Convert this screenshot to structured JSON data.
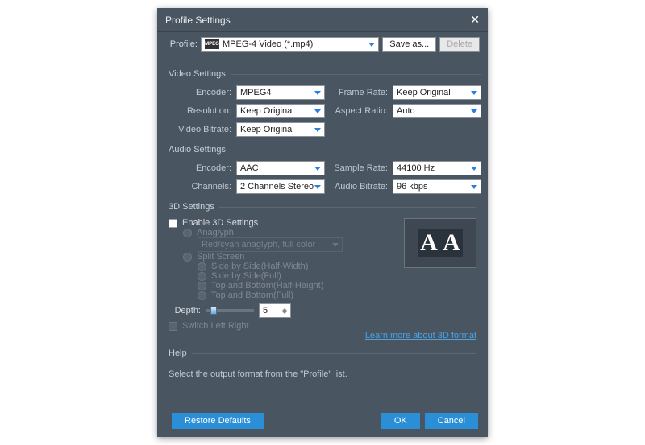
{
  "title": "Profile Settings",
  "profile": {
    "label": "Profile:",
    "value": "MPEG-4 Video (*.mp4)",
    "save_as": "Save as...",
    "delete": "Delete"
  },
  "video": {
    "legend": "Video Settings",
    "encoder_label": "Encoder:",
    "encoder": "MPEG4",
    "resolution_label": "Resolution:",
    "resolution": "Keep Original",
    "bitrate_label": "Video Bitrate:",
    "bitrate": "Keep Original",
    "framerate_label": "Frame Rate:",
    "framerate": "Keep Original",
    "aspect_label": "Aspect Ratio:",
    "aspect": "Auto"
  },
  "audio": {
    "legend": "Audio Settings",
    "encoder_label": "Encoder:",
    "encoder": "AAC",
    "channels_label": "Channels:",
    "channels": "2 Channels Stereo",
    "samplerate_label": "Sample Rate:",
    "samplerate": "44100 Hz",
    "bitrate_label": "Audio Bitrate:",
    "bitrate": "96 kbps"
  },
  "threeD": {
    "legend": "3D Settings",
    "enable": "Enable 3D Settings",
    "anaglyph": "Anaglyph",
    "anaglyph_mode": "Red/cyan anaglyph, full color",
    "split": "Split Screen",
    "sbs_half": "Side by Side(Half-Width)",
    "sbs_full": "Side by Side(Full)",
    "tb_half": "Top and Bottom(Half-Height)",
    "tb_full": "Top and Bottom(Full)",
    "depth_label": "Depth:",
    "depth_value": "5",
    "switch_lr": "Switch Left Right",
    "preview_text": "A",
    "learn_more": "Learn more about 3D format"
  },
  "help": {
    "legend": "Help",
    "text": "Select the output format from the \"Profile\" list."
  },
  "footer": {
    "restore": "Restore Defaults",
    "ok": "OK",
    "cancel": "Cancel"
  }
}
